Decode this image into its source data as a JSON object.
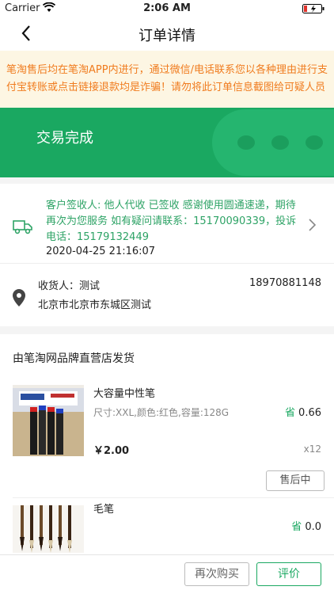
{
  "status_bar": {
    "carrier": "Carrier",
    "time": "2:06 AM"
  },
  "nav": {
    "title": "订单详情",
    "back_icon": "chevron-left-icon"
  },
  "notice": {
    "text": "笔淘售后均在笔淘APP内进行，通过微信/电话联系您以各种理由进行支付宝转账或点击链接退款均是诈骗！请勿将此订单信息截图给可疑人员"
  },
  "order_status": {
    "label": "交易完成"
  },
  "logistics": {
    "message": "客户签收人: 他人代收 已签收  感谢使用圆通速递，期待再次为您服务 如有疑问请联系：15170090339，投诉电话：15179132449",
    "timestamp": "2020-04-25 21:16:07"
  },
  "receiver": {
    "label": "收货人：测试",
    "phone": "18970881148",
    "address": "北京市北京市东城区测试"
  },
  "shop": {
    "label": "由笔淘网品牌直营店发货"
  },
  "products": [
    {
      "name": "大容量中性笔",
      "spec": "尺寸:XXL,颜色:红色,容量:128G",
      "save_tag": "省",
      "save_amount": "0.66",
      "price": "￥2.00",
      "qty": "x12",
      "after_sale_label": "售后中"
    },
    {
      "name": "毛笔",
      "save_tag": "省",
      "save_amount": "0.0"
    }
  ],
  "actions": {
    "rebuy_label": "再次购买",
    "review_label": "评价"
  },
  "colors": {
    "accent": "#1aa861",
    "notice_text": "#f07c1f",
    "notice_bg": "#fdf6e3"
  }
}
